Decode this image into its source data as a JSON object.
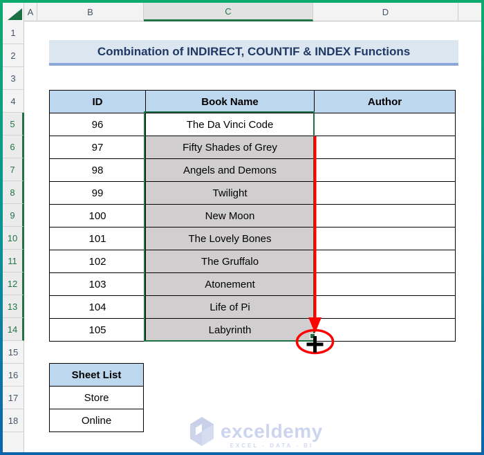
{
  "grid": {
    "col_letters": [
      "A",
      "B",
      "C",
      "D"
    ],
    "selected_col": "C",
    "row_numbers": [
      "1",
      "2",
      "3",
      "4",
      "5",
      "6",
      "7",
      "8",
      "9",
      "10",
      "11",
      "12",
      "13",
      "14",
      "15",
      "16",
      "17",
      "18"
    ],
    "selected_rows": "5-14",
    "selected_range": "C5:C14"
  },
  "banner": {
    "title": "Combination of INDIRECT, COUNTIF & INDEX Functions"
  },
  "book_table": {
    "headers": [
      "ID",
      "Book Name",
      "Author"
    ],
    "rows": [
      {
        "id": "96",
        "book": "The Da Vinci Code",
        "author": ""
      },
      {
        "id": "97",
        "book": "Fifty Shades of Grey",
        "author": ""
      },
      {
        "id": "98",
        "book": "Angels and Demons",
        "author": ""
      },
      {
        "id": "99",
        "book": "Twilight",
        "author": ""
      },
      {
        "id": "100",
        "book": "New Moon",
        "author": ""
      },
      {
        "id": "101",
        "book": "The Lovely Bones",
        "author": ""
      },
      {
        "id": "102",
        "book": "The Gruffalo",
        "author": ""
      },
      {
        "id": "103",
        "book": "Atonement",
        "author": ""
      },
      {
        "id": "104",
        "book": "Life of Pi",
        "author": ""
      },
      {
        "id": "105",
        "book": "Labyrinth",
        "author": ""
      }
    ]
  },
  "sheet_list": {
    "header": "Sheet List",
    "rows": [
      "Store",
      "Online"
    ]
  },
  "watermark": {
    "brand": "exceldemy",
    "tagline": "EXCEL - DATA - BI"
  },
  "colors": {
    "accent_green": "#217346",
    "selection_fill": "#d0cece",
    "table_header_fill": "#bdd7ee",
    "banner_fill": "#dce6f1",
    "banner_border": "#8ca6d8",
    "banner_text": "#1f3864",
    "annotation_red": "#fe0202",
    "frame_gradient_top": "#0caa6e",
    "frame_gradient_bottom": "#0e63a8"
  }
}
